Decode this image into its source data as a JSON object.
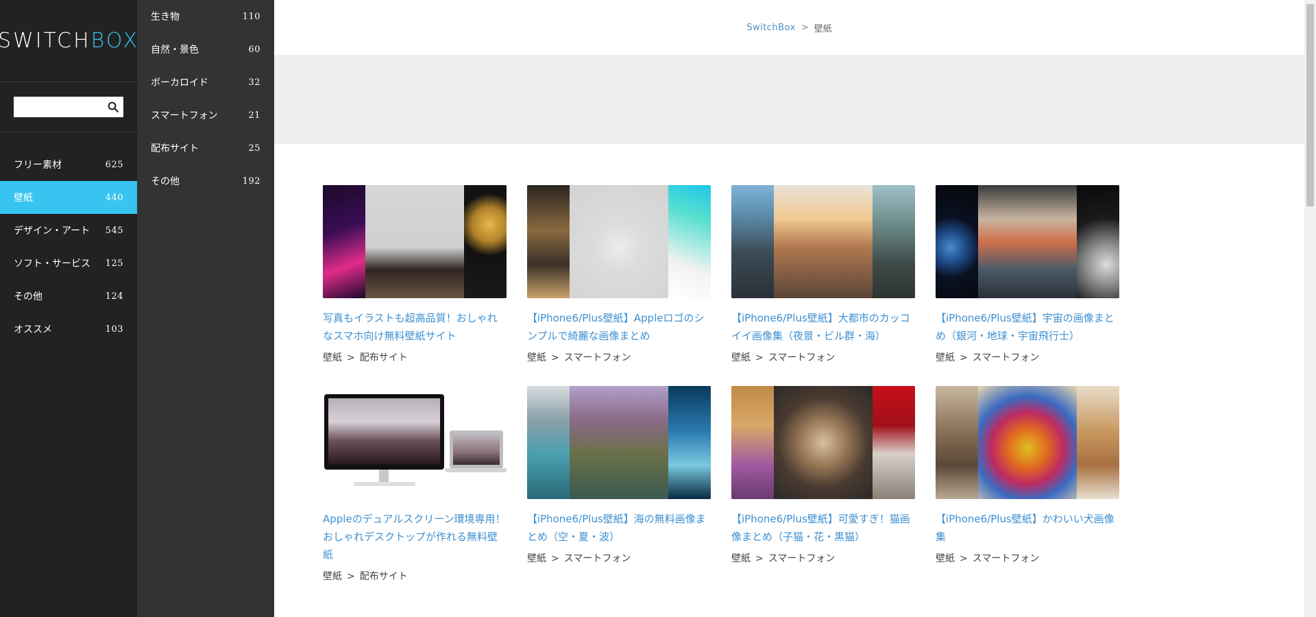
{
  "logo": {
    "part1": "SWITCH",
    "part2": "BOX"
  },
  "search": {
    "placeholder": "",
    "value": ""
  },
  "nav_primary": [
    {
      "label": "フリー素材",
      "count": "625",
      "active": false
    },
    {
      "label": "壁紙",
      "count": "440",
      "active": true
    },
    {
      "label": "デザイン・アート",
      "count": "545",
      "active": false
    },
    {
      "label": "ソフト・サービス",
      "count": "125",
      "active": false
    },
    {
      "label": "その他",
      "count": "124",
      "active": false
    },
    {
      "label": "オススメ",
      "count": "103",
      "active": false
    }
  ],
  "nav_secondary": [
    {
      "label": "生き物",
      "count": "110"
    },
    {
      "label": "自然・景色",
      "count": "60"
    },
    {
      "label": "ボーカロイド",
      "count": "32"
    },
    {
      "label": "スマートフォン",
      "count": "21"
    },
    {
      "label": "配布サイト",
      "count": "25"
    },
    {
      "label": "その他",
      "count": "192"
    }
  ],
  "breadcrumb": {
    "home": "SwitchBox",
    "separator": ">",
    "current": "壁紙"
  },
  "articles": [
    {
      "title": "写真もイラストも超高品質！おしゃれなスマホ向け無料壁紙サイト",
      "cat1": "壁紙",
      "cat2": "配布サイト"
    },
    {
      "title": "【iPhone6/Plus壁紙】Appleロゴのシンプルで綺麗な画像まとめ",
      "cat1": "壁紙",
      "cat2": "スマートフォン"
    },
    {
      "title": "【iPhone6/Plus壁紙】大都市のカッコイイ画像集（夜景・ビル群・海）",
      "cat1": "壁紙",
      "cat2": "スマートフォン"
    },
    {
      "title": "【iPhone6/Plus壁紙】宇宙の画像まとめ（銀河・地球・宇宙飛行士）",
      "cat1": "壁紙",
      "cat2": "スマートフォン"
    },
    {
      "title": "Appleのデュアルスクリーン環境専用！おしゃれデスクトップが作れる無料壁紙",
      "cat1": "壁紙",
      "cat2": "配布サイト"
    },
    {
      "title": "【iPhone6/Plus壁紙】海の無料画像まとめ（空・夏・波）",
      "cat1": "壁紙",
      "cat2": "スマートフォン"
    },
    {
      "title": "【iPhone6/Plus壁紙】可愛すぎ！猫画像まとめ（子猫・花・黒猫）",
      "cat1": "壁紙",
      "cat2": "スマートフォン"
    },
    {
      "title": "【iPhone6/Plus壁紙】かわいい犬画像集",
      "cat1": "壁紙",
      "cat2": "スマートフォン"
    }
  ],
  "colors": {
    "accent": "#37c4f0",
    "link": "#3d8fd1",
    "sidebar_dark": "#222222",
    "sidebar_mid": "#333333"
  }
}
